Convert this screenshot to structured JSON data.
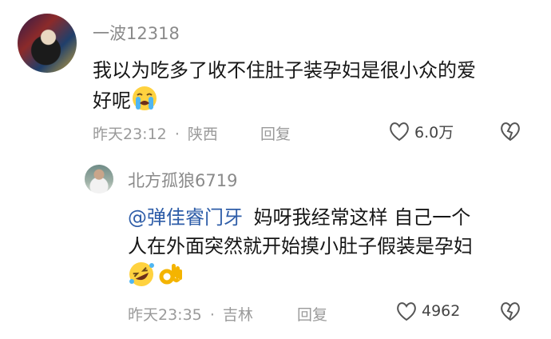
{
  "comment": {
    "username": "一波12318",
    "text_line1": "我以为吃多了收不住肚子装孕妇是很小众的爱",
    "text_line2": "好呢",
    "emoji": "loudly-crying-face",
    "time": "昨天23:12",
    "separator": "·",
    "location": "陕西",
    "reply_label": "回复",
    "likes": "6.0万"
  },
  "reply": {
    "username": "北方孤狼6719",
    "mention": "@弹佳睿门牙",
    "text_line1": "妈呀我经常这样 自己一个",
    "text_line2": "人在外面突然就开始摸小肚子假装是孕妇",
    "emojis": [
      "rolling-on-floor-laughing-face",
      "ok-hand"
    ],
    "time": "昨天23:35",
    "separator": "·",
    "location": "吉林",
    "reply_label": "回复",
    "likes": "4962"
  }
}
